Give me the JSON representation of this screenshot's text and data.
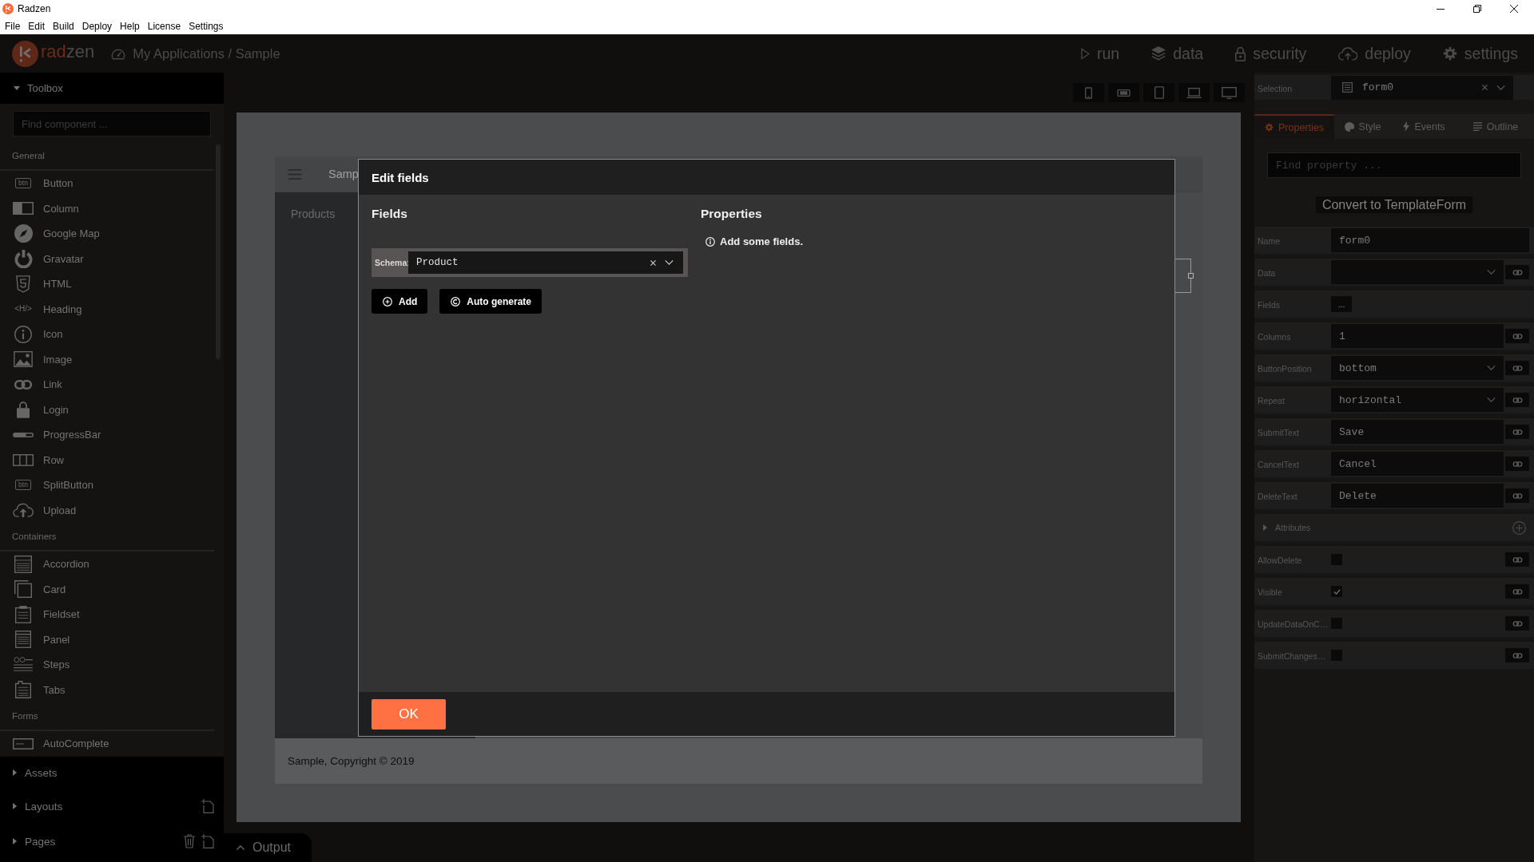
{
  "window": {
    "title": "Radzen"
  },
  "menu": [
    {
      "label": "File"
    },
    {
      "label": "Edit"
    },
    {
      "label": "Build"
    },
    {
      "label": "Deploy"
    },
    {
      "label": "Help"
    },
    {
      "label": "License"
    },
    {
      "label": "Settings"
    }
  ],
  "app_header": {
    "wordmark": [
      "rad",
      "zen"
    ],
    "breadcrumb": "My Applications / Sample",
    "nav": [
      {
        "label": "run"
      },
      {
        "label": "data"
      },
      {
        "label": "security"
      },
      {
        "label": "deploy"
      },
      {
        "label": "settings"
      }
    ]
  },
  "toolbox": {
    "title": "Toolbox",
    "expanded": true,
    "search": {
      "placeholder": "Find component ..."
    },
    "groups": [
      {
        "label": "General",
        "items": [
          {
            "label": "Button",
            "icon_text": "btn"
          },
          {
            "label": "Column"
          },
          {
            "label": "Google Map"
          },
          {
            "label": "Gravatar"
          },
          {
            "label": "HTML"
          },
          {
            "label": "Heading",
            "icon_text": "<H/>"
          },
          {
            "label": "Icon"
          },
          {
            "label": "Image"
          },
          {
            "label": "Link"
          },
          {
            "label": "Login"
          },
          {
            "label": "ProgressBar"
          },
          {
            "label": "Row"
          },
          {
            "label": "SplitButton",
            "icon_text": "btn"
          },
          {
            "label": "Upload"
          }
        ]
      },
      {
        "label": "Containers",
        "items": [
          {
            "label": "Accordion"
          },
          {
            "label": "Card"
          },
          {
            "label": "Fieldset"
          },
          {
            "label": "Panel"
          },
          {
            "label": "Steps"
          },
          {
            "label": "Tabs"
          }
        ]
      },
      {
        "label": "Forms",
        "items": [
          {
            "label": "AutoComplete"
          }
        ]
      }
    ]
  },
  "sections": [
    {
      "label": "Assets",
      "expanded": false
    },
    {
      "label": "Layouts",
      "expanded": false
    },
    {
      "label": "Pages",
      "expanded": false
    }
  ],
  "canvas": {
    "page_title": "Samp",
    "sidebar_items": [
      {
        "label": "Products"
      }
    ],
    "footer": "Sample, Copyright © 2019"
  },
  "output_panel": {
    "label": "Output",
    "expanded": false
  },
  "dialog": {
    "title": "Edit fields",
    "fields": {
      "heading": "Fields",
      "schema": {
        "label": "Schema:",
        "value": "Product"
      },
      "buttons": [
        {
          "label": "Add"
        },
        {
          "label": "Auto generate"
        }
      ]
    },
    "properties": {
      "heading": "Properties",
      "message": "Add some fields."
    },
    "ok_button": "OK"
  },
  "properties_panel": {
    "selection": {
      "label": "Selection",
      "value": "form0"
    },
    "tabs": [
      {
        "label": "Properties",
        "selected": true
      },
      {
        "label": "Style",
        "selected": false
      },
      {
        "label": "Events",
        "selected": false
      },
      {
        "label": "Outline",
        "selected": false
      }
    ],
    "search": {
      "placeholder": "Find property ..."
    },
    "convert_button": "Convert to TemplateForm",
    "rows": [
      {
        "kind": "text",
        "label": "Name",
        "value": "form0",
        "bindable": false
      },
      {
        "kind": "dropdown",
        "label": "Data",
        "bindable": true
      },
      {
        "kind": "editor",
        "label": "Fields",
        "button": "...",
        "bindable": false
      },
      {
        "kind": "text",
        "label": "Columns",
        "value": "1",
        "bindable": true
      },
      {
        "kind": "dropdown",
        "label": "ButtonPosition",
        "value": "bottom",
        "bindable": true
      },
      {
        "kind": "dropdown",
        "label": "Repeat",
        "value": "horizontal",
        "bindable": true
      },
      {
        "kind": "text",
        "label": "SubmitText",
        "value": "Save",
        "bindable": true
      },
      {
        "kind": "text",
        "label": "CancelText",
        "value": "Cancel",
        "bindable": true
      },
      {
        "kind": "text",
        "label": "DeleteText",
        "value": "Delete",
        "bindable": true
      },
      {
        "kind": "group",
        "label": "Attributes",
        "expanded": false
      },
      {
        "kind": "checkbox",
        "label": "AllowDelete",
        "checked": false,
        "bindable": true
      },
      {
        "kind": "checkbox",
        "label": "Visible",
        "checked": true,
        "bindable": true
      },
      {
        "kind": "checkbox",
        "label": "UpdateDataOnC…",
        "checked": false,
        "bindable": true
      },
      {
        "kind": "checkbox",
        "label": "SubmitChanges…",
        "checked": false,
        "bindable": true
      }
    ]
  }
}
